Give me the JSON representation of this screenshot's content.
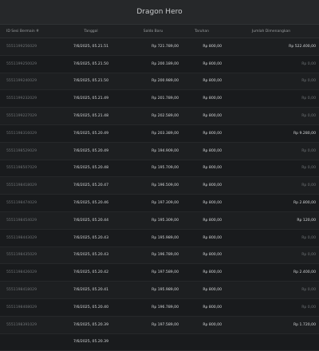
{
  "header": {
    "title": "Dragon Hero"
  },
  "columns": {
    "id": "ID Sesi Bermain #",
    "date": "Tanggal",
    "saldo": "Saldo Baru",
    "bet": "Taruhan",
    "win": "Jumlah Dimenangkan"
  },
  "rows": [
    {
      "id": "5551199256029",
      "date": "7/6/2025, 05.21.51",
      "saldo": "Rp 721.789,00",
      "bet": "Rp 800,00",
      "win": "Rp 522.400,00",
      "zero": false
    },
    {
      "id": "5551199250029",
      "date": "7/6/2025, 05.21.50",
      "saldo": "Rp 200.189,00",
      "bet": "Rp 800,00",
      "win": "Rp 0,00",
      "zero": true
    },
    {
      "id": "5551199240029",
      "date": "7/6/2025, 05.21.50",
      "saldo": "Rp 200.989,00",
      "bet": "Rp 800,00",
      "win": "Rp 0,00",
      "zero": true
    },
    {
      "id": "5551199232029",
      "date": "7/6/2025, 05.21.49",
      "saldo": "Rp 201.789,00",
      "bet": "Rp 800,00",
      "win": "Rp 0,00",
      "zero": true
    },
    {
      "id": "5551199227029",
      "date": "7/6/2025, 05.21.48",
      "saldo": "Rp 202.589,00",
      "bet": "Rp 800,00",
      "win": "Rp 0,00",
      "zero": true
    },
    {
      "id": "5551198316029",
      "date": "7/6/2025, 05.20.49",
      "saldo": "Rp 203.389,00",
      "bet": "Rp 800,00",
      "win": "Rp 9.280,00",
      "zero": false
    },
    {
      "id": "5551198529029",
      "date": "7/6/2025, 05.20.49",
      "saldo": "Rp 194.909,00",
      "bet": "Rp 800,00",
      "win": "Rp 0,00",
      "zero": true
    },
    {
      "id": "5551198507029",
      "date": "7/6/2025, 05.20.48",
      "saldo": "Rp 195.709,00",
      "bet": "Rp 800,00",
      "win": "Rp 0,00",
      "zero": true
    },
    {
      "id": "5551198418029",
      "date": "7/6/2025, 05.20.47",
      "saldo": "Rp 196.509,00",
      "bet": "Rp 800,00",
      "win": "Rp 0,00",
      "zero": true
    },
    {
      "id": "5551198474029",
      "date": "7/6/2025, 05.20.46",
      "saldo": "Rp 197.309,00",
      "bet": "Rp 800,00",
      "win": "Rp 2.800,00",
      "zero": false
    },
    {
      "id": "5551198454029",
      "date": "7/6/2025, 05.20.44",
      "saldo": "Rp 195.309,00",
      "bet": "Rp 800,00",
      "win": "Rp 120,00",
      "zero": false
    },
    {
      "id": "5551198443029",
      "date": "7/6/2025, 05.20.43",
      "saldo": "Rp 195.989,00",
      "bet": "Rp 800,00",
      "win": "Rp 0,00",
      "zero": true
    },
    {
      "id": "5551198435029",
      "date": "7/6/2025, 05.20.43",
      "saldo": "Rp 196.789,00",
      "bet": "Rp 800,00",
      "win": "Rp 0,00",
      "zero": true
    },
    {
      "id": "5551198426029",
      "date": "7/6/2025, 05.20.42",
      "saldo": "Rp 197.589,00",
      "bet": "Rp 800,00",
      "win": "Rp 2.400,00",
      "zero": false
    },
    {
      "id": "5551198418029",
      "date": "7/6/2025, 05.20.41",
      "saldo": "Rp 195.989,00",
      "bet": "Rp 800,00",
      "win": "Rp 0,00",
      "zero": true
    },
    {
      "id": "5551198408029",
      "date": "7/6/2025, 05.20.40",
      "saldo": "Rp 196.789,00",
      "bet": "Rp 800,00",
      "win": "Rp 0,00",
      "zero": true
    },
    {
      "id": "5551198391029",
      "date": "7/6/2025, 05.20.39",
      "saldo": "Rp 197.589,00",
      "bet": "Rp 800,00",
      "win": "Rp 1.720,00",
      "zero": false
    },
    {
      "id": "",
      "date": "7/6/2025, 05.20.39",
      "saldo": "",
      "bet": "",
      "win": "",
      "zero": true
    }
  ]
}
